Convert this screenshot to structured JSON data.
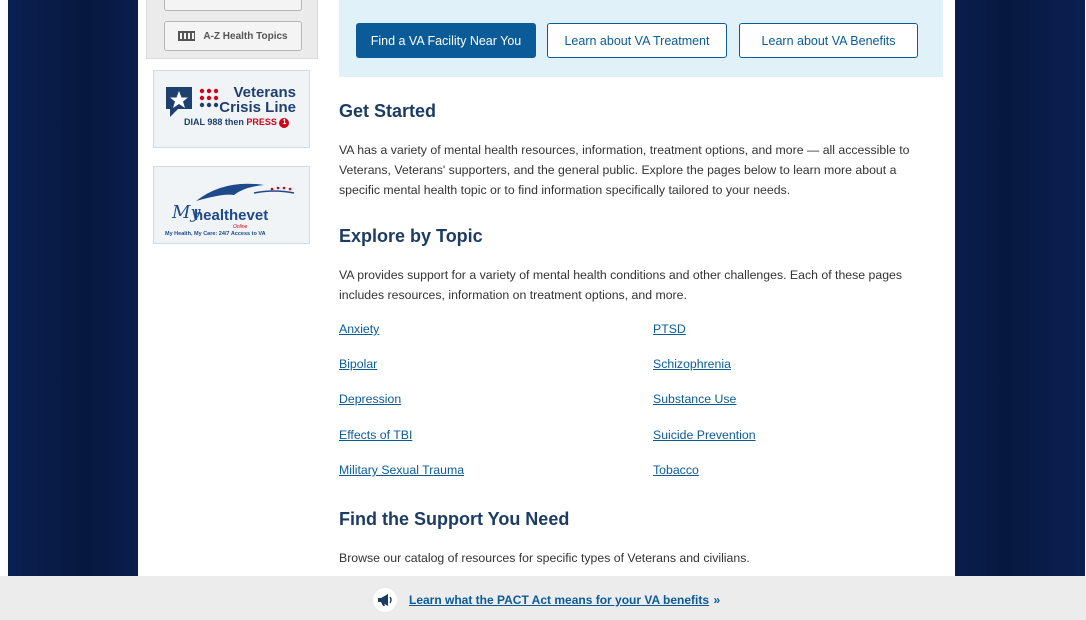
{
  "sidebar": {
    "az_label": "A-Z Health Topics",
    "crisis_line": {
      "line1": "Veterans",
      "line2": "Crisis Line",
      "dial": "DIAL 988 then",
      "press": "PRESS"
    },
    "myhealthevet": {
      "title": "healthevet",
      "script": "My",
      "online": "Online",
      "tagline": "My Health, My Care: 24/7 Access to VA"
    }
  },
  "cta": {
    "find_facility": "Find a VA Facility Near You",
    "treatment": "Learn about VA Treatment",
    "benefits": "Learn about VA Benefits"
  },
  "get_started": {
    "heading": "Get Started",
    "text": "VA has a variety of mental health resources, information, treatment options, and more — all accessible to Veterans, Veterans' supporters, and the general public. Explore the pages below to learn more about a specific mental health topic or to find information specifically tailored to your needs."
  },
  "explore": {
    "heading": "Explore by Topic",
    "text": "VA provides support for a variety of mental health conditions and other challenges. Each of these pages includes resources, information on treatment options, and more.",
    "topics_left": [
      "Anxiety",
      "Bipolar",
      "Depression",
      "Effects of TBI",
      "Military Sexual Trauma"
    ],
    "topics_right": [
      "PTSD",
      "Schizophrenia",
      "Substance Use",
      "Suicide Prevention",
      "Tobacco"
    ]
  },
  "support": {
    "heading": "Find the Support You Need",
    "text": "Browse our catalog of resources for specific types of Veterans and civilians."
  },
  "pact_banner": {
    "link": "Learn what the PACT Act means for your VA benefits",
    "chevron": "»"
  },
  "colors": {
    "navy_bg": "#07183f",
    "link_blue": "#0a5b98",
    "heading": "#1c3c63",
    "cta_bar": "#e1f1f9"
  }
}
